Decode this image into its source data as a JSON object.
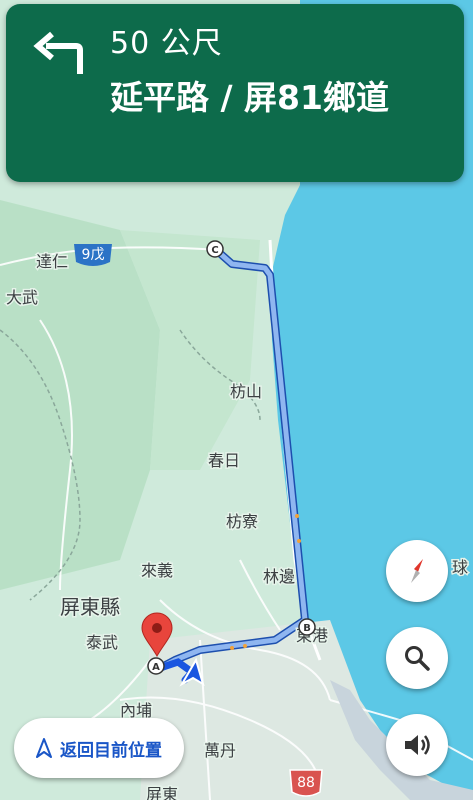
{
  "nav": {
    "distance": "50 公尺",
    "street": "延平路 / 屏81鄉道"
  },
  "map": {
    "route_badge": "9戊",
    "places": {
      "daren": "達仁",
      "dawu": "大武",
      "fangshan": "枋山",
      "chunri": "春日",
      "fangliao": "枋寮",
      "laiyi": "來義",
      "linbian": "林邊",
      "county": "屏東縣",
      "taiwu": "泰武",
      "donggang": "東港",
      "neipu": "內埔",
      "wandan": "萬丹",
      "pingtung": "屏東",
      "qiu": "球"
    },
    "road_badge": "88",
    "stops": {
      "a": "A",
      "b": "B",
      "c": "C"
    }
  },
  "controls": {
    "recenter_label": "返回目前位置",
    "compass_icon": "compass-icon",
    "search_icon": "search-icon",
    "sound_icon": "volume-icon"
  },
  "colors": {
    "banner": "#0d6b4b",
    "route": "#2f6fe0",
    "route_alt": "#8fb6f0",
    "sea": "#5cc8e6",
    "land": "#cfeadb"
  }
}
